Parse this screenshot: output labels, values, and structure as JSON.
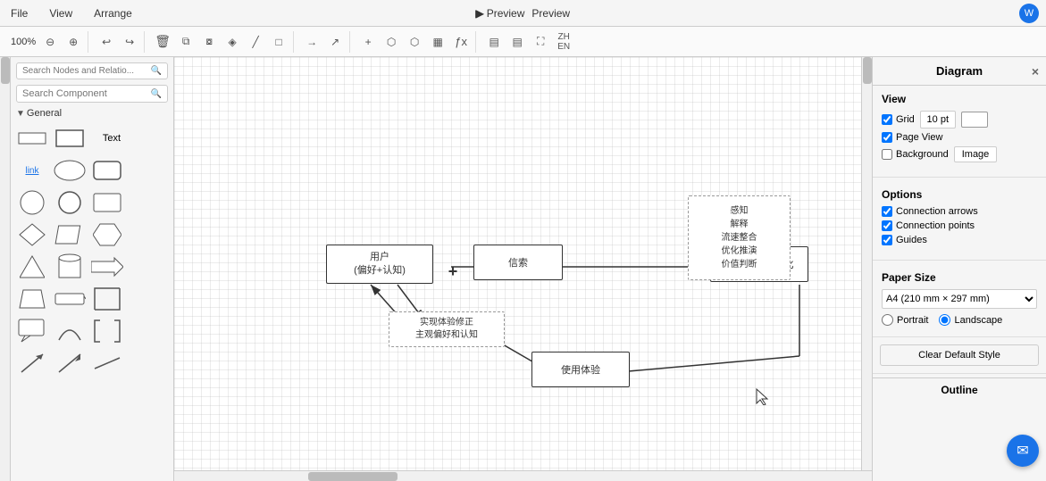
{
  "menu": {
    "file": "File",
    "view": "View",
    "arrange": "Arrange",
    "preview": "▶ Preview"
  },
  "toolbar": {
    "zoom": "100%",
    "zoom_in": "+",
    "zoom_out": "−",
    "undo": "↩",
    "redo": "↪"
  },
  "left_panel": {
    "search_nodes_placeholder": "Search Nodes and Relatio...",
    "search_component_placeholder": "Search Component",
    "general_label": "General",
    "text_label": "Text"
  },
  "right_panel": {
    "title": "Diagram",
    "view_label": "View",
    "grid_label": "Grid",
    "grid_value": "10 pt",
    "page_view_label": "Page View",
    "background_label": "Background",
    "image_btn": "Image",
    "options_label": "Options",
    "connection_arrows": "Connection arrows",
    "connection_points": "Connection points",
    "guides": "Guides",
    "paper_size_label": "Paper Size",
    "paper_size_value": "A4 (210 mm × 297 mm)",
    "portrait": "Portrait",
    "landscape": "Landscape",
    "clear_style_btn": "Clear Default Style",
    "outline_label": "Outline"
  },
  "diagram": {
    "node1_text": "用户\n(偏好+认知)",
    "node2_text": "信索",
    "node3_text": "期望效果最大化",
    "node4_text": "感知\n解释\n流速整合\n优化推演\n价值判断",
    "node5_text": "实现体验修正\n主观偏好和认知",
    "node6_text": "使用体验",
    "plus_text": "+"
  },
  "icons": {
    "search": "🔍",
    "play": "▶",
    "close": "×",
    "user": "W",
    "chat": "✉",
    "undo": "↩",
    "redo": "↪",
    "delete": "⌫",
    "zoom_in": "⊕",
    "zoom_out": "⊖"
  }
}
